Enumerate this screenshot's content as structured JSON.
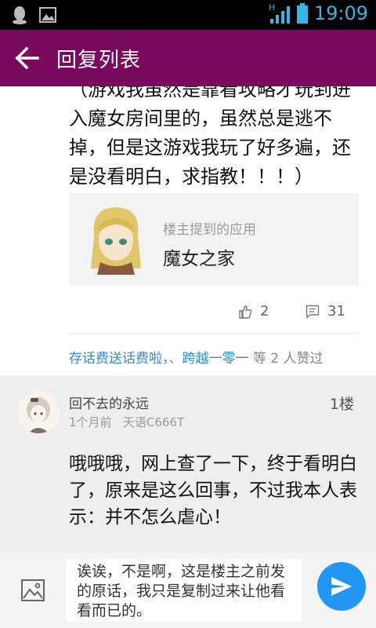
{
  "status_bar": {
    "time": "19:09",
    "network": "H",
    "icons": [
      "qq-icon",
      "image-notification-icon",
      "signal-icon",
      "battery-icon"
    ]
  },
  "app_bar": {
    "title": "回复列表",
    "back_icon": "arrow-left-icon",
    "color": "#7a0a5e"
  },
  "post": {
    "text": "（游戏我虽然是靠看攻略才玩到进入魔女房间里的，虽然总是逃不掉，但是这游戏我玩了好多遍，还是没看明白，求指教！！！）",
    "app_card": {
      "caption": "楼主提到的应用",
      "name": "魔女之家"
    },
    "likes": "2",
    "comments": "31",
    "likers": {
      "user1": "存话费送话费啦，",
      "separator": "、",
      "user2": "跨越一零一",
      "suffix": " 等 2 人赞过"
    }
  },
  "reply": {
    "username": "回不去的永远",
    "time": "1个月前",
    "device": "天语C666T",
    "floor": "1楼",
    "text": "哦哦哦，网上查了一下，终于看明白了，原来是这么回事，不过我本人表示：并不怎么虐心！"
  },
  "composer": {
    "text": "诶诶，不是啊，这是楼主之前发的原话，我只是复制过来让他看看而已的。",
    "send_color": "#2196f3"
  }
}
